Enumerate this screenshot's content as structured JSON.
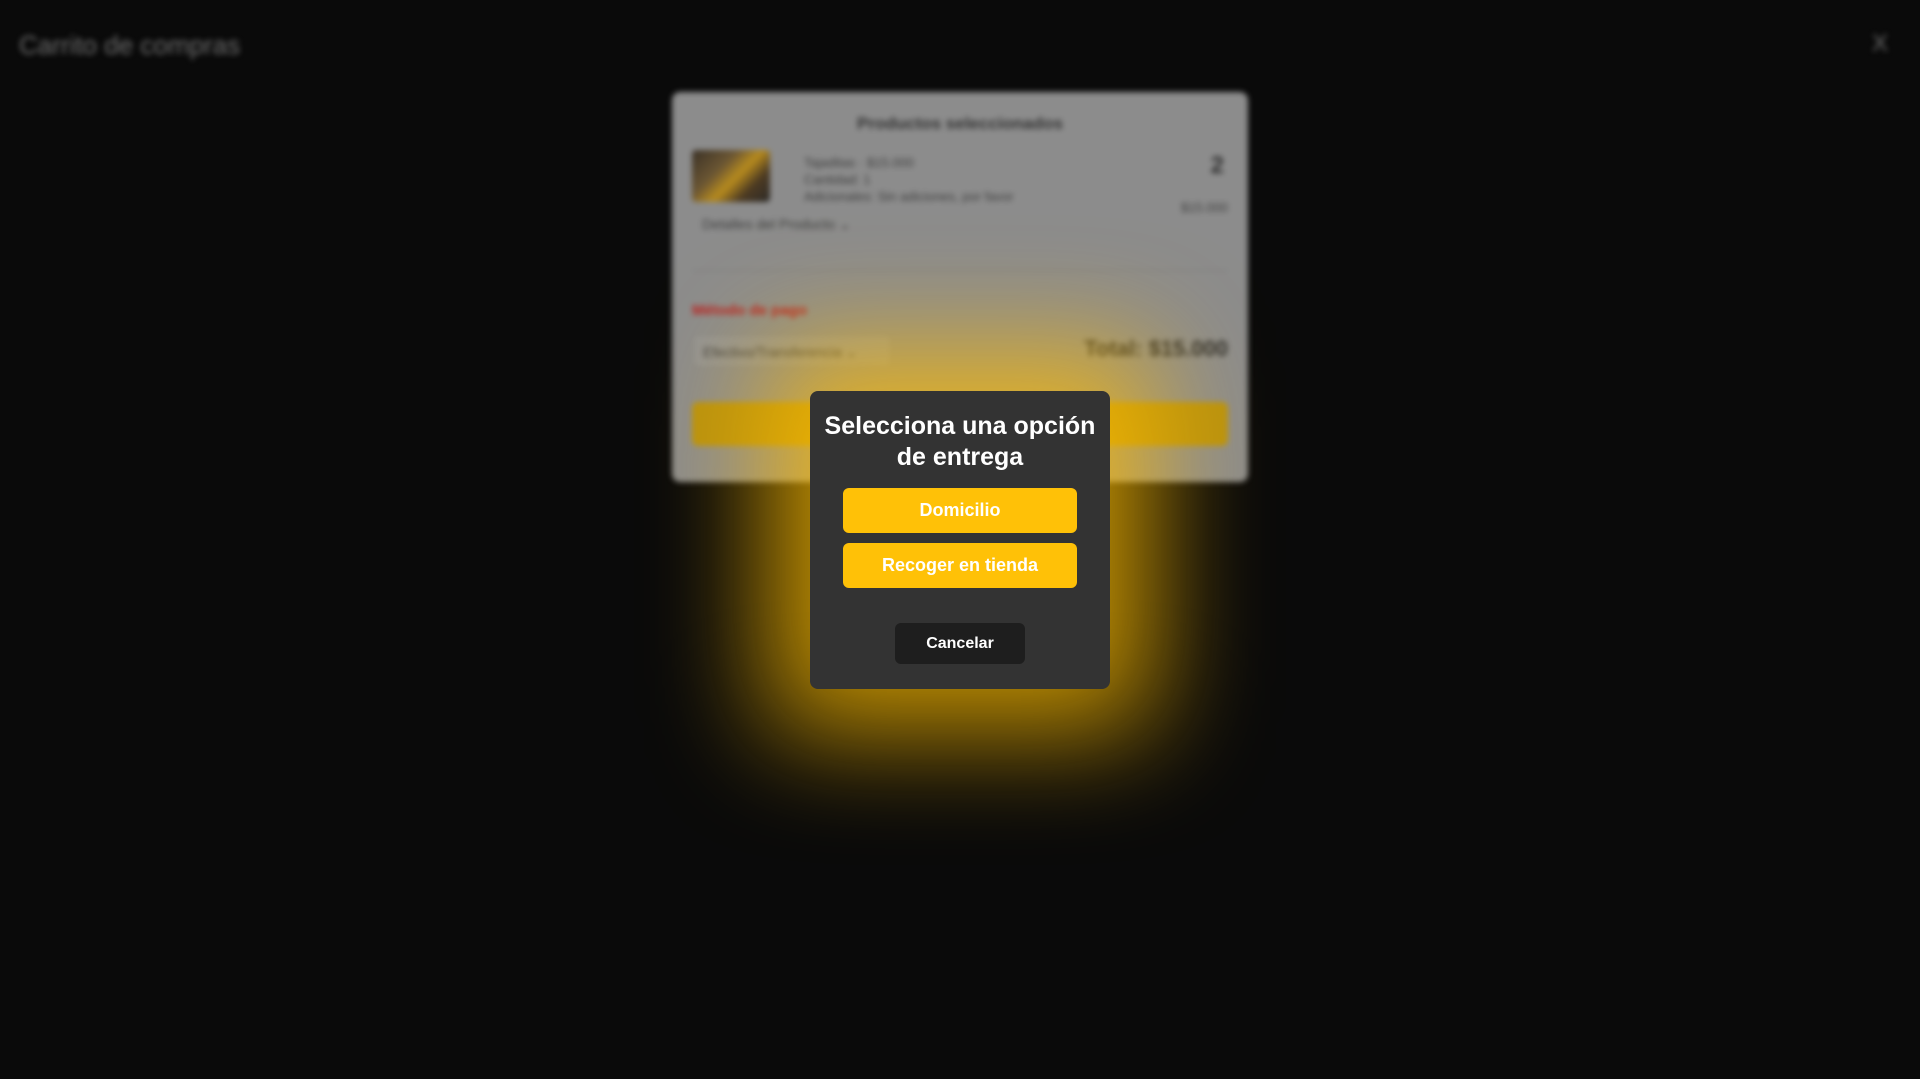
{
  "header": {
    "title": "Carrito de compras",
    "close_label": "X"
  },
  "cart": {
    "heading": "Productos seleccionados",
    "item": {
      "image_icon": "product-photo",
      "line1": "Tajaditas · $15.000",
      "line2": "Cantidad: 1",
      "line3": "Adicionales: Sin adiciones, por favor",
      "quantity": "2",
      "subtotal": "$15.000",
      "details_toggle": "Detalles del Producto ⌄"
    },
    "payment_label": "Método de pago",
    "payment_selected": "Efectivo/Transferencia ⌄",
    "total": "Total: $15.000"
  },
  "modal": {
    "title": "Selecciona una opción de entrega",
    "options": [
      "Domicilio",
      "Recoger en tienda"
    ],
    "cancel": "Cancelar"
  },
  "colors": {
    "accent": "#ffc107",
    "modal_bg": "#333333",
    "cancel_bg": "#1e1e1e",
    "page_bg": "#0a0a0a"
  }
}
